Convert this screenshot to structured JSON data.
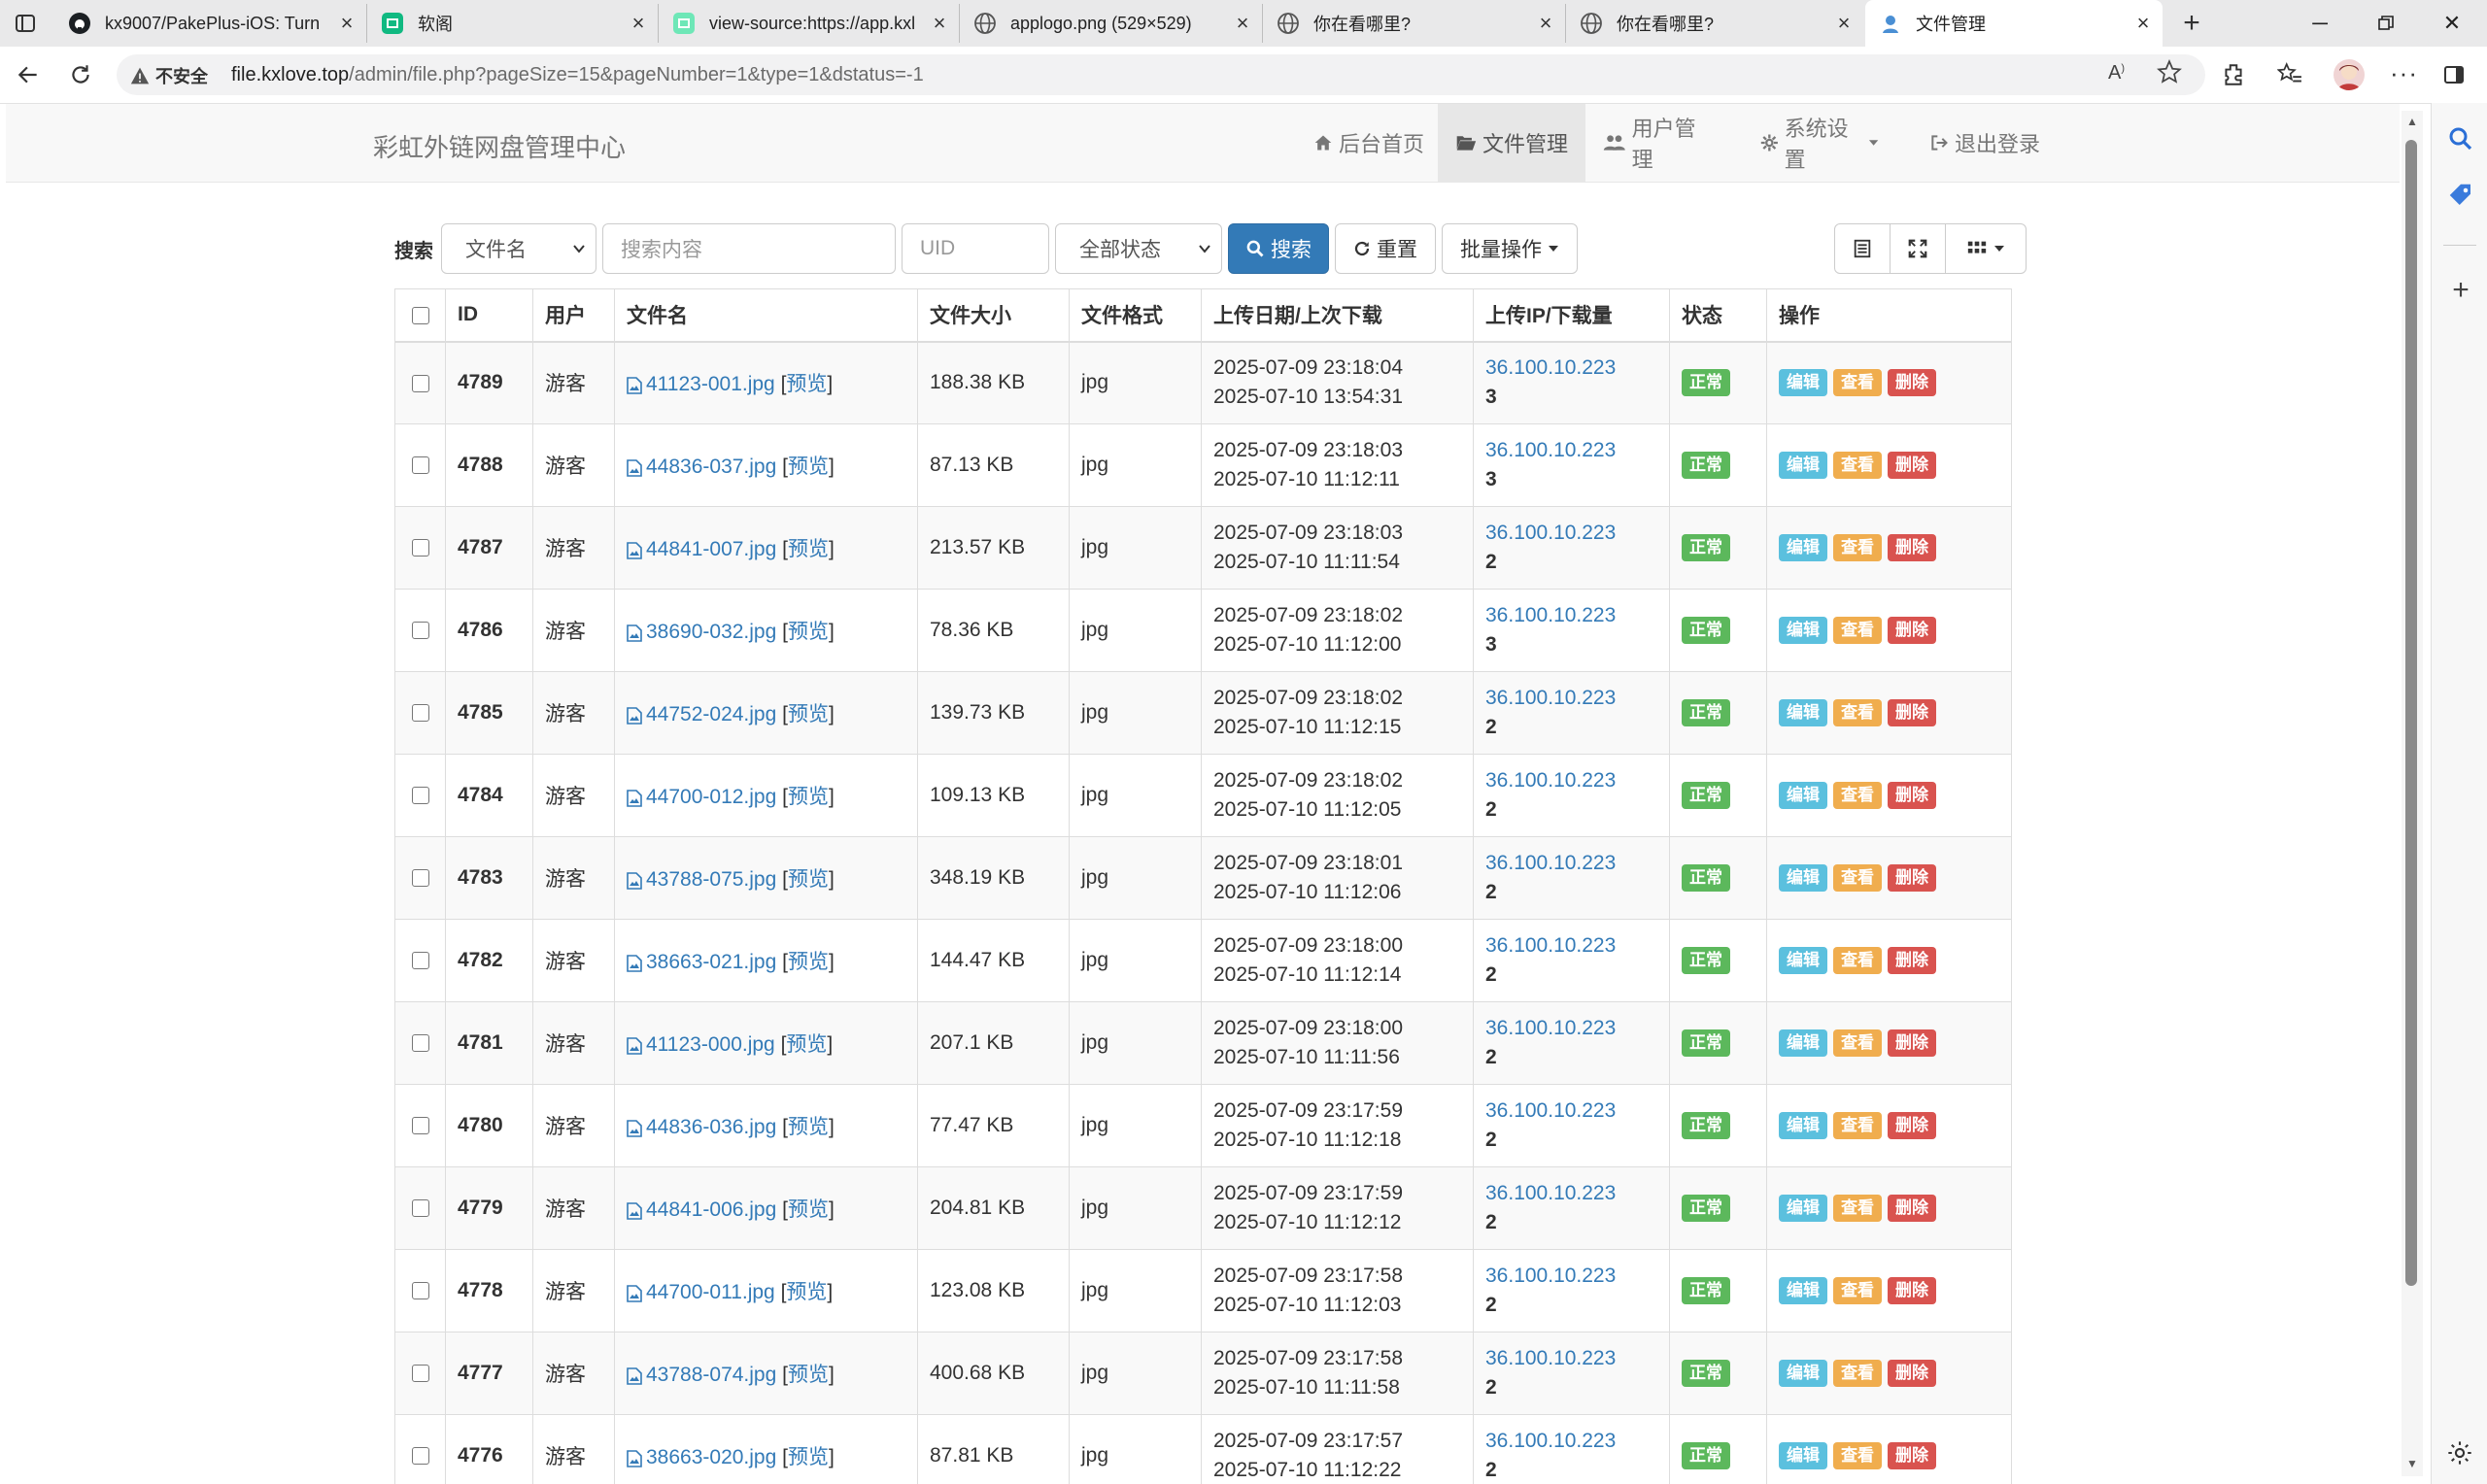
{
  "browser": {
    "tabs": [
      {
        "title": "kx9007/PakePlus-iOS: Turn"
      },
      {
        "title": "软阁"
      },
      {
        "title": "view-source:https://app.kxl"
      },
      {
        "title": "applogo.png (529×529)"
      },
      {
        "title": "你在看哪里?"
      },
      {
        "title": "你在看哪里?"
      },
      {
        "title": "文件管理"
      }
    ],
    "security_label": "不安全",
    "url_host": "file.kxlove.top",
    "url_path": "/admin/file.php?pageSize=15&pageNumber=1&type=1&dstatus=-1"
  },
  "site": {
    "brand": "彩虹外链网盘管理中心",
    "nav": [
      {
        "label": "后台首页"
      },
      {
        "label": "文件管理"
      },
      {
        "label": "用户管理"
      },
      {
        "label": "系统设置"
      },
      {
        "label": "退出登录"
      }
    ]
  },
  "search": {
    "label": "搜索",
    "field_selected": "文件名",
    "content_placeholder": "搜索内容",
    "uid_placeholder": "UID",
    "status_selected": "全部状态",
    "search_button": "搜索",
    "reset_button": "重置",
    "batch_button": "批量操作"
  },
  "table": {
    "headers": [
      "ID",
      "用户",
      "文件名",
      "文件大小",
      "文件格式",
      "上传日期/上次下载",
      "上传IP/下载量",
      "状态",
      "操作"
    ],
    "preview_text": "预览",
    "actions": {
      "edit": "编辑",
      "view": "查看",
      "delete": "删除"
    },
    "rows": [
      {
        "id": "4789",
        "user": "游客",
        "name": "41123-001.jpg",
        "size": "188.38 KB",
        "format": "jpg",
        "upload": "2025-07-09 23:18:04",
        "last": "2025-07-10 13:54:31",
        "ip": "36.100.10.223",
        "downloads": "3",
        "status": "正常"
      },
      {
        "id": "4788",
        "user": "游客",
        "name": "44836-037.jpg",
        "size": "87.13 KB",
        "format": "jpg",
        "upload": "2025-07-09 23:18:03",
        "last": "2025-07-10 11:12:11",
        "ip": "36.100.10.223",
        "downloads": "3",
        "status": "正常"
      },
      {
        "id": "4787",
        "user": "游客",
        "name": "44841-007.jpg",
        "size": "213.57 KB",
        "format": "jpg",
        "upload": "2025-07-09 23:18:03",
        "last": "2025-07-10 11:11:54",
        "ip": "36.100.10.223",
        "downloads": "2",
        "status": "正常"
      },
      {
        "id": "4786",
        "user": "游客",
        "name": "38690-032.jpg",
        "size": "78.36 KB",
        "format": "jpg",
        "upload": "2025-07-09 23:18:02",
        "last": "2025-07-10 11:12:00",
        "ip": "36.100.10.223",
        "downloads": "3",
        "status": "正常"
      },
      {
        "id": "4785",
        "user": "游客",
        "name": "44752-024.jpg",
        "size": "139.73 KB",
        "format": "jpg",
        "upload": "2025-07-09 23:18:02",
        "last": "2025-07-10 11:12:15",
        "ip": "36.100.10.223",
        "downloads": "2",
        "status": "正常"
      },
      {
        "id": "4784",
        "user": "游客",
        "name": "44700-012.jpg",
        "size": "109.13 KB",
        "format": "jpg",
        "upload": "2025-07-09 23:18:02",
        "last": "2025-07-10 11:12:05",
        "ip": "36.100.10.223",
        "downloads": "2",
        "status": "正常"
      },
      {
        "id": "4783",
        "user": "游客",
        "name": "43788-075.jpg",
        "size": "348.19 KB",
        "format": "jpg",
        "upload": "2025-07-09 23:18:01",
        "last": "2025-07-10 11:12:06",
        "ip": "36.100.10.223",
        "downloads": "2",
        "status": "正常"
      },
      {
        "id": "4782",
        "user": "游客",
        "name": "38663-021.jpg",
        "size": "144.47 KB",
        "format": "jpg",
        "upload": "2025-07-09 23:18:00",
        "last": "2025-07-10 11:12:14",
        "ip": "36.100.10.223",
        "downloads": "2",
        "status": "正常"
      },
      {
        "id": "4781",
        "user": "游客",
        "name": "41123-000.jpg",
        "size": "207.1 KB",
        "format": "jpg",
        "upload": "2025-07-09 23:18:00",
        "last": "2025-07-10 11:11:56",
        "ip": "36.100.10.223",
        "downloads": "2",
        "status": "正常"
      },
      {
        "id": "4780",
        "user": "游客",
        "name": "44836-036.jpg",
        "size": "77.47 KB",
        "format": "jpg",
        "upload": "2025-07-09 23:17:59",
        "last": "2025-07-10 11:12:18",
        "ip": "36.100.10.223",
        "downloads": "2",
        "status": "正常"
      },
      {
        "id": "4779",
        "user": "游客",
        "name": "44841-006.jpg",
        "size": "204.81 KB",
        "format": "jpg",
        "upload": "2025-07-09 23:17:59",
        "last": "2025-07-10 11:12:12",
        "ip": "36.100.10.223",
        "downloads": "2",
        "status": "正常"
      },
      {
        "id": "4778",
        "user": "游客",
        "name": "44700-011.jpg",
        "size": "123.08 KB",
        "format": "jpg",
        "upload": "2025-07-09 23:17:58",
        "last": "2025-07-10 11:12:03",
        "ip": "36.100.10.223",
        "downloads": "2",
        "status": "正常"
      },
      {
        "id": "4777",
        "user": "游客",
        "name": "43788-074.jpg",
        "size": "400.68 KB",
        "format": "jpg",
        "upload": "2025-07-09 23:17:58",
        "last": "2025-07-10 11:11:58",
        "ip": "36.100.10.223",
        "downloads": "2",
        "status": "正常"
      },
      {
        "id": "4776",
        "user": "游客",
        "name": "38663-020.jpg",
        "size": "87.81 KB",
        "format": "jpg",
        "upload": "2025-07-09 23:17:57",
        "last": "2025-07-10 11:12:22",
        "ip": "36.100.10.223",
        "downloads": "2",
        "status": "正常"
      }
    ]
  },
  "colors": {
    "primary": "#337ab7",
    "success": "#5cb85c",
    "info": "#5bc0de",
    "warning": "#f0ad4e",
    "danger": "#d9534f"
  }
}
